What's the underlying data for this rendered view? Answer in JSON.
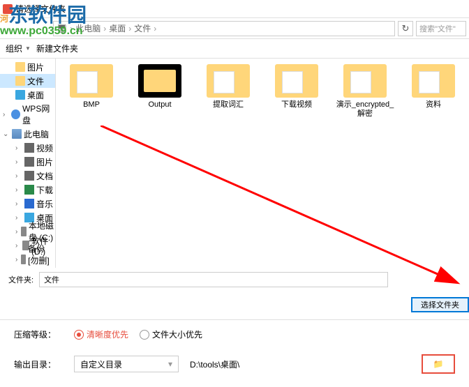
{
  "watermark": {
    "name": "河东软件园",
    "url": "www.pc0359.cn"
  },
  "window": {
    "title": "请选择文件夹"
  },
  "breadcrumb": {
    "items": [
      "此电脑",
      "桌面",
      "文件"
    ]
  },
  "search": {
    "placeholder": "搜索\"文件\""
  },
  "toolbar": {
    "organize": "组织",
    "newfolder": "新建文件夹"
  },
  "sidebar": {
    "items": [
      {
        "label": "图片",
        "type": "folder"
      },
      {
        "label": "文件",
        "type": "folder",
        "selected": true
      },
      {
        "label": "桌面",
        "type": "folder"
      },
      {
        "label": "WPS网盘",
        "type": "wps",
        "expandable": true
      },
      {
        "label": "此电脑",
        "type": "pc",
        "expanded": true
      },
      {
        "label": "视频",
        "type": "folder"
      },
      {
        "label": "图片",
        "type": "folder"
      },
      {
        "label": "文档",
        "type": "folder"
      },
      {
        "label": "下载",
        "type": "folder"
      },
      {
        "label": "音乐",
        "type": "folder"
      },
      {
        "label": "桌面",
        "type": "folder"
      },
      {
        "label": "本地磁盘 (C:)",
        "type": "drive"
      },
      {
        "label": "软件 (D:)",
        "type": "drive"
      },
      {
        "label": "备份[勿删] (E:)",
        "type": "drive"
      }
    ]
  },
  "folders": [
    {
      "name": "BMP"
    },
    {
      "name": "Output",
      "selected": true
    },
    {
      "name": "提取词汇"
    },
    {
      "name": "下载视频"
    },
    {
      "name": "演示_encrypted_解密"
    },
    {
      "name": "资料"
    }
  ],
  "folderField": {
    "label": "文件夹:",
    "value": "文件"
  },
  "selectButton": "选择文件夹",
  "compress": {
    "label": "压缩等级：",
    "opt1": "清晰度优先",
    "opt2": "文件大小优先"
  },
  "output": {
    "label": "输出目录：",
    "mode": "自定义目录",
    "path": "D:\\tools\\桌面\\"
  }
}
